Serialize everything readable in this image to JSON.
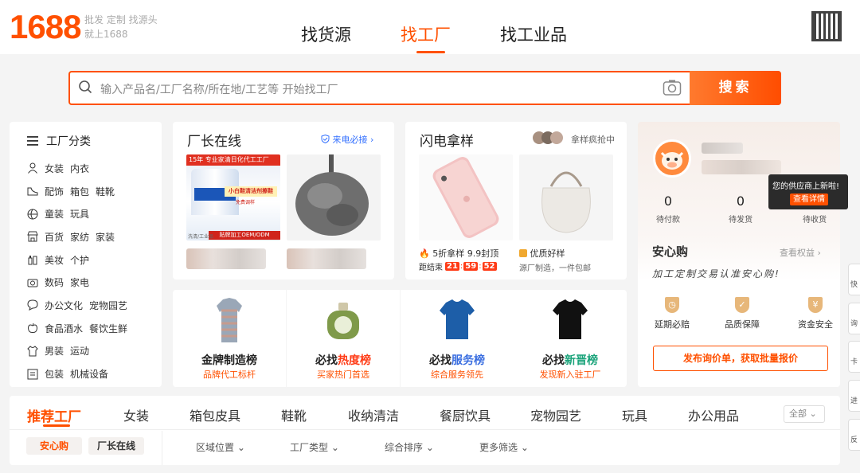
{
  "header": {
    "logo": "1688",
    "slogan_line1": "批发 定制 找源头",
    "slogan_line2": "就上1688",
    "tabs": [
      {
        "label": "找货源"
      },
      {
        "label": "找工厂",
        "active": true
      },
      {
        "label": "找工业品"
      }
    ],
    "qr_icon": "qr-code-icon"
  },
  "search": {
    "placeholder": "输入产品名/工厂名称/所在地/工艺等 开始找工厂",
    "button": "搜索"
  },
  "categories": {
    "title": "工厂分类",
    "items": [
      {
        "icon": "person-icon",
        "labels": [
          "女装",
          "内衣"
        ]
      },
      {
        "icon": "shoe-icon",
        "labels": [
          "配饰",
          "箱包",
          "鞋靴"
        ]
      },
      {
        "icon": "ball-icon",
        "labels": [
          "童装",
          "玩具"
        ]
      },
      {
        "icon": "store-icon",
        "labels": [
          "百货",
          "家纺",
          "家装"
        ]
      },
      {
        "icon": "bottle-icon",
        "labels": [
          "美妆",
          "个护"
        ]
      },
      {
        "icon": "camera-icon",
        "labels": [
          "数码",
          "家电"
        ]
      },
      {
        "icon": "chat-icon",
        "labels": [
          "办公文化",
          "宠物园艺"
        ]
      },
      {
        "icon": "apple-icon",
        "labels": [
          "食品酒水",
          "餐饮生鲜"
        ]
      },
      {
        "icon": "shirt-icon",
        "labels": [
          "男装",
          "运动"
        ]
      },
      {
        "icon": "box-icon",
        "labels": [
          "包装",
          "机械设备"
        ]
      }
    ]
  },
  "factory_owner": {
    "title": "厂长在线",
    "tag": "来电必接",
    "img1_top": "15年 专业家清日化代工工厂",
    "img1_mid": "小白鞋清洁剂擦鞋",
    "img1_mid2": "免费调样",
    "img1_bottom": "贴牌加工OEM/ODM",
    "img1_foot": "洗清/工业品"
  },
  "sample": {
    "title": "闪电拿样",
    "tag": "拿样疯抢中",
    "left_line1": "5折拿样 9.9封顶",
    "left_countdown_label": "距结束",
    "countdown": [
      "21",
      "59",
      "52"
    ],
    "right_line1": "优质好样",
    "right_line2": "源厂制造，一件包邮"
  },
  "rankings": [
    {
      "pre": "",
      "hl": "金牌制造榜",
      "sub": "品牌代工标杆",
      "name_color": "#222"
    },
    {
      "pre": "必找",
      "hl": "热度榜",
      "sub": "买家热门首选"
    },
    {
      "pre": "必找",
      "hl": "服务榜",
      "sub": "综合服务领先"
    },
    {
      "pre": "必找",
      "hl": "新晋榜",
      "sub": "发现新入驻工厂"
    }
  ],
  "user_panel": {
    "stats": [
      {
        "value": "0",
        "label": "待付款"
      },
      {
        "value": "0",
        "label": "待发货"
      },
      {
        "value": "",
        "label": "待收货"
      }
    ],
    "tooltip_text": "您的供应商上新啦!",
    "tooltip_btn": "查看详情",
    "anxin_title": "安心购",
    "anxin_link": "查看权益",
    "anxin_slogan": "加工定制交易认准安心购!",
    "guarantees": [
      {
        "icon": "clock-shield-icon",
        "label": "延期必赔"
      },
      {
        "icon": "check-shield-icon",
        "label": "品质保障"
      },
      {
        "icon": "yen-shield-icon",
        "label": "资金安全"
      }
    ],
    "cta": "发布询价单，获取批量报价"
  },
  "bottom": {
    "tabs": [
      "推荐工厂",
      "女装",
      "箱包皮具",
      "鞋靴",
      "收纳清洁",
      "餐厨饮具",
      "宠物园艺",
      "玩具",
      "办公用品"
    ],
    "all_select": "全部",
    "chips": [
      "安心购",
      "厂长在线"
    ],
    "filters": [
      "区域位置",
      "工厂类型",
      "综合排序",
      "更多筛选"
    ]
  },
  "side": [
    "快",
    "询",
    "卡",
    "进",
    "反"
  ],
  "colors": {
    "accent": "#ff5000"
  }
}
